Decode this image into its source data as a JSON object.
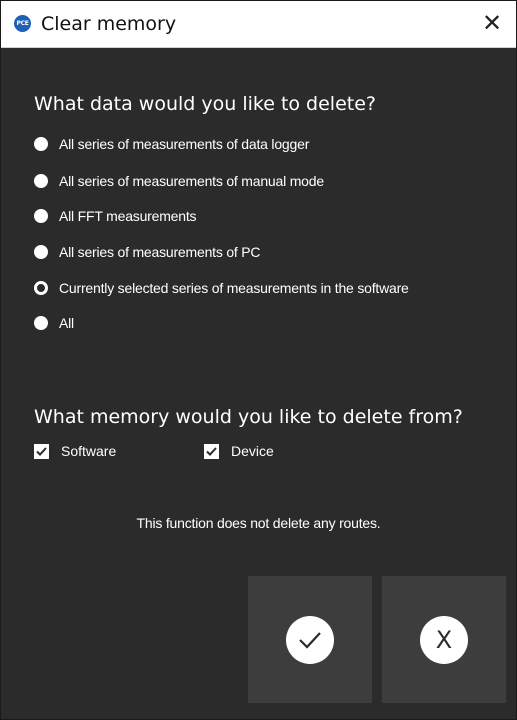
{
  "window": {
    "title": "Clear memory",
    "logo_text": "PCE",
    "close_glyph": "✕"
  },
  "data_section": {
    "heading": "What data would you like to delete?",
    "options": [
      {
        "label": "All series of measurements of data logger",
        "selected": false
      },
      {
        "label": "All series of measurements of manual mode",
        "selected": false
      },
      {
        "label": "All FFT measurements",
        "selected": false
      },
      {
        "label": "All series of measurements of PC",
        "selected": false
      },
      {
        "label": "Currently selected series of measurements in the software",
        "selected": true
      },
      {
        "label": "All",
        "selected": false
      }
    ]
  },
  "memory_section": {
    "heading": "What memory would you like to delete from?",
    "software": {
      "label": "Software",
      "checked": true
    },
    "device": {
      "label": "Device",
      "checked": true
    }
  },
  "note": "This function does not delete any routes.",
  "buttons": {
    "confirm_icon": "checkmark-icon",
    "cancel_glyph": "X"
  },
  "colors": {
    "background": "#2b2b2b",
    "button_bg": "#3d3d3d",
    "text": "#ffffff",
    "logo": "#1f5fb5"
  }
}
